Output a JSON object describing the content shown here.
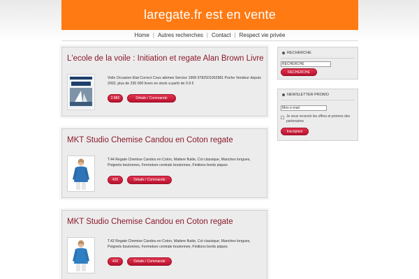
{
  "site": {
    "title": "laregate.fr est en vente"
  },
  "nav": {
    "items": [
      "Home",
      "Autres recherches",
      "Contact",
      "Respect vie privée"
    ]
  },
  "products": [
    {
      "title": "L'ecole de la voile : Initiation et regate Alan Brown Livre",
      "description": "Voile Occasion Etat Correct Couv abimee Service 1968 9782501002981 Poche Vendeur depuis 2002, plus de 230 000 livres en stock a partir de 0.9 €",
      "price": "2.88€",
      "details_label": "Détails / Commande",
      "thumb_icon": "book-cover"
    },
    {
      "title": "MKT Studio Chemise Candou en Coton regate",
      "description": "T.44 Regate Chemise Candou en Coton, Matiere fluide, Col classique, Manches longues, Poignets boutonnes, Fermeture centrale boutonnee, Finitions bords piques",
      "price": "42€",
      "details_label": "Détails / Commande",
      "thumb_icon": "shirt-model"
    },
    {
      "title": "MKT Studio Chemise Candou en Coton regate",
      "description": "T.42 Regate Chemise Candou en Coton, Matiere fluide, Col classique, Manches longues, Poignets boutonnes, Fermeture centrale boutonnee, Finitions bords piques",
      "price": "42€",
      "details_label": "Détails / Commande",
      "thumb_icon": "shirt-model"
    }
  ],
  "sidebar": {
    "search": {
      "heading": "RECHERCHE",
      "value": "RECHERCHE",
      "button": "RECHERCHE"
    },
    "newsletter": {
      "heading": "NEWSLETTER PROMO",
      "email_value": "Mon e-mail",
      "optin_text": "Je veux recevoir les offres et promos des partenaires",
      "button": "Inscription"
    }
  },
  "colors": {
    "header": "#ff7a12",
    "title": "#8a1a2a",
    "button": "#c8193a"
  }
}
